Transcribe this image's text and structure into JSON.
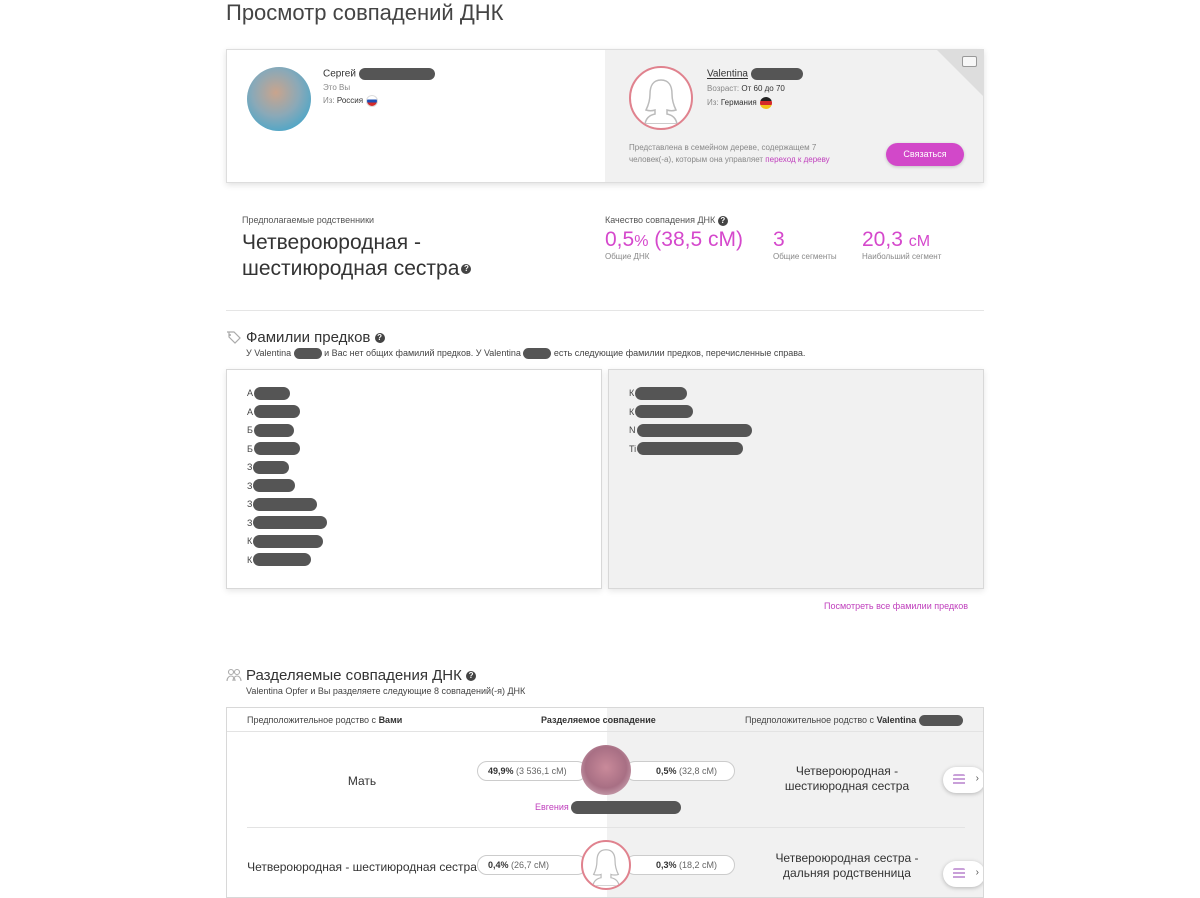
{
  "page": {
    "title": "Просмотр совпадений ДНК"
  },
  "me": {
    "name": "Сергей",
    "you_label": "Это Вы",
    "from_label": "Из:",
    "country": "Россия"
  },
  "match": {
    "name": "Valentina",
    "age_label": "Возраст:",
    "age_value": "От 60 до 70",
    "from_label": "Из:",
    "country": "Германия",
    "tree_text": "Представлена в семейном дереве, содержащем 7 человек(-а), которым она управляет",
    "tree_link": "переход к дереву",
    "contact_button": "Связаться"
  },
  "relationship": {
    "label": "Предполагаемые родственники",
    "value": "Четвероюродная - шестиюродная сестра"
  },
  "quality": {
    "label": "Качество совпадения ДНК",
    "shared_dna_pct": "0,5",
    "pct_sign": "%",
    "shared_dna_cm": "(38,5 сМ)",
    "shared_dna_label": "Общие ДНК",
    "segments": "3",
    "segments_label": "Общие сегменты",
    "largest_segment": "20,3",
    "largest_unit": "сМ",
    "largest_label": "Наибольший сегмент"
  },
  "surnames": {
    "title": "Фамилии предков",
    "subtitle_a": "У Valentina",
    "subtitle_b": "и Вас нет общих фамилий предков. У Valentina",
    "subtitle_c": "есть следующие фамилии предков, перечисленные справа.",
    "mine": [
      "А",
      "А",
      "Б",
      "Б",
      "З",
      "З",
      "З",
      "З",
      "К",
      "К"
    ],
    "theirs": [
      "К",
      "К",
      "N",
      "Ti"
    ],
    "view_all": "Посмотреть все фамилии предков"
  },
  "shared": {
    "title": "Разделяемые совпадения ДНК",
    "subtitle": "Valentina Opfer и Вы разделяете следующие 8 совпадений(-я) ДНК",
    "col_left_prefix": "Предположительное родство с",
    "col_left_bold": "Вами",
    "col_mid": "Разделяемое совпадение",
    "col_right_prefix": "Предположительное родство с",
    "col_right_bold": "Valentina",
    "rows": [
      {
        "left_rel": "Мать",
        "left_pct": "49,9%",
        "left_cm": "(3 536,1 сМ)",
        "right_pct": "0,5%",
        "right_cm": "(32,8 сМ)",
        "name": "Евгения",
        "right_rel": "Четвероюродная - шестиюродная сестра"
      },
      {
        "left_rel": "Четвероюродная - шестиюродная сестра",
        "left_pct": "0,4%",
        "left_cm": "(26,7 сМ)",
        "right_pct": "0,3%",
        "right_cm": "(18,2 сМ)",
        "name": "",
        "right_rel": "Четвероюродная сестра - дальняя родственница"
      }
    ]
  }
}
